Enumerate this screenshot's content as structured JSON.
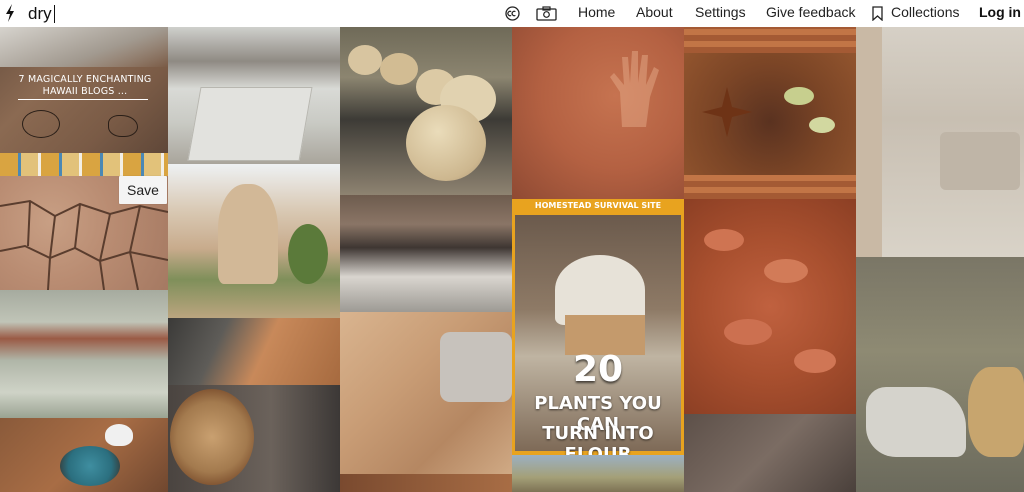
{
  "search": {
    "query": "dry"
  },
  "nav": {
    "home": "Home",
    "about": "About",
    "settings": "Settings",
    "feedback": "Give feedback",
    "collections": "Collections",
    "login": "Log in"
  },
  "icons": {
    "logo": "lightning-bolt-icon",
    "license": "creative-commons-icon",
    "camera": "camera-icon",
    "bookmark": "bookmark-icon"
  },
  "tiles": {
    "hawaii_blogs": {
      "title": "7 MAGICALLY ENCHANTING HAWAII BLOGS ..."
    },
    "flour_poster": {
      "site": "HOMESTEAD SURVIVAL SITE",
      "number": "20",
      "line1": "PLANTS YOU CAN",
      "line2": "TURN INTO FLOUR"
    },
    "save_label": "Save"
  },
  "colors": {
    "poster_orange": "#e8a31f",
    "poster_text": "#ffffff",
    "header_bg": "#ffffff"
  }
}
